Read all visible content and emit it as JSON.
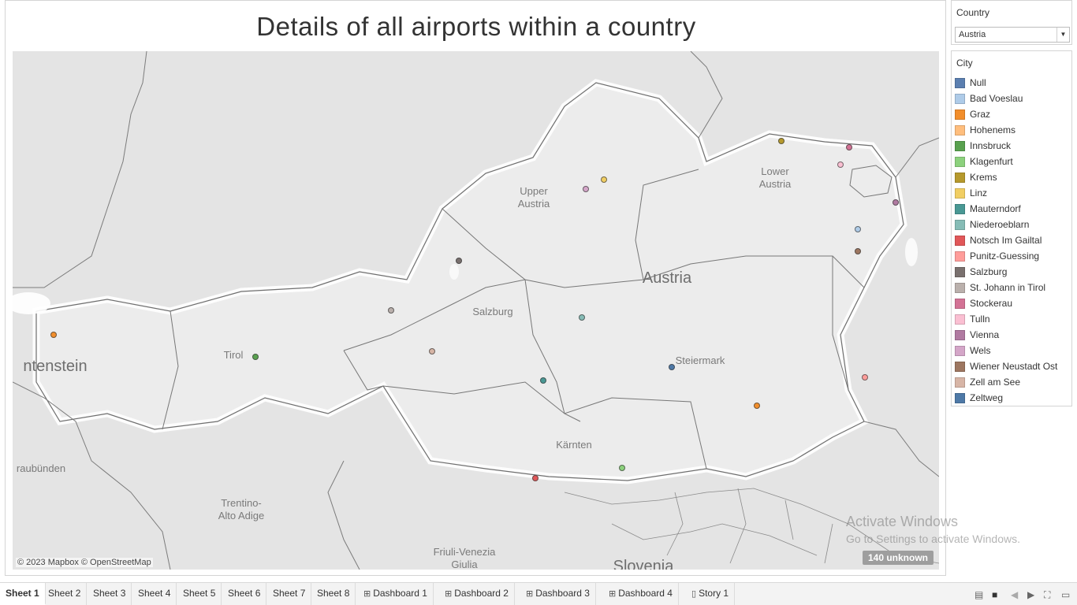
{
  "dashboard": {
    "title": "Details of all airports within a country"
  },
  "map": {
    "labels": {
      "upper_austria": "Upper\nAustria",
      "lower_austria": "Lower\nAustria",
      "austria": "Austria",
      "salzburg": "Salzburg",
      "tirol": "Tirol",
      "steiermark": "Steiermark",
      "kaernten": "Kärnten",
      "liechtenstein": "ntenstein",
      "graubuenden": "raubünden",
      "trentino": "Trentino-\nAlto Adige",
      "friuli": "Friuli-Venezia\nGiulia",
      "slovenia": "Slovenia"
    },
    "attribution": "© 2023 Mapbox © OpenStreetMap",
    "unknown_badge": "140 unknown"
  },
  "filter": {
    "title": "Country",
    "selected": "Austria"
  },
  "legend": {
    "title": "City",
    "items": [
      {
        "label": "Null",
        "color": "#5b7fb0"
      },
      {
        "label": "Bad Voeslau",
        "color": "#aecbe8"
      },
      {
        "label": "Graz",
        "color": "#f28e2b"
      },
      {
        "label": "Hohenems",
        "color": "#ffbe7d"
      },
      {
        "label": "Innsbruck",
        "color": "#59a14f"
      },
      {
        "label": "Klagenfurt",
        "color": "#8cd17d"
      },
      {
        "label": "Krems",
        "color": "#b6992d"
      },
      {
        "label": "Linz",
        "color": "#f1ce63"
      },
      {
        "label": "Mauterndorf",
        "color": "#499894"
      },
      {
        "label": "Niederoeblarn",
        "color": "#86bcb6"
      },
      {
        "label": "Notsch Im Gailtal",
        "color": "#e15759"
      },
      {
        "label": "Punitz-Guessing",
        "color": "#ff9d9a"
      },
      {
        "label": "Salzburg",
        "color": "#79706e"
      },
      {
        "label": "St. Johann in Tirol",
        "color": "#bab0ac"
      },
      {
        "label": "Stockerau",
        "color": "#d37295"
      },
      {
        "label": "Tulln",
        "color": "#fabfd2"
      },
      {
        "label": "Vienna",
        "color": "#b07aa1"
      },
      {
        "label": "Wels",
        "color": "#d4a6c8"
      },
      {
        "label": "Wiener Neustadt Ost",
        "color": "#9d7660"
      },
      {
        "label": "Zell am See",
        "color": "#d7b5a6"
      },
      {
        "label": "Zeltweg",
        "color": "#4e79a7"
      }
    ]
  },
  "tabs": [
    {
      "label": "Sheet 1",
      "icon": "",
      "active": true
    },
    {
      "label": "Sheet 2",
      "icon": ""
    },
    {
      "label": "Sheet 3",
      "icon": ""
    },
    {
      "label": "Sheet 4",
      "icon": ""
    },
    {
      "label": "Sheet 5",
      "icon": ""
    },
    {
      "label": "Sheet 6",
      "icon": ""
    },
    {
      "label": "Sheet 7",
      "icon": ""
    },
    {
      "label": "Sheet 8",
      "icon": ""
    },
    {
      "label": "Dashboard 1",
      "icon": "dashboard-icon"
    },
    {
      "label": "Dashboard 2",
      "icon": "dashboard-icon"
    },
    {
      "label": "Dashboard 3",
      "icon": "dashboard-icon"
    },
    {
      "label": "Dashboard 4",
      "icon": "dashboard-icon"
    },
    {
      "label": "Story 1",
      "icon": "story-icon"
    }
  ],
  "watermark": {
    "line1": "Activate Windows",
    "line2": "Go to Settings to activate Windows."
  }
}
